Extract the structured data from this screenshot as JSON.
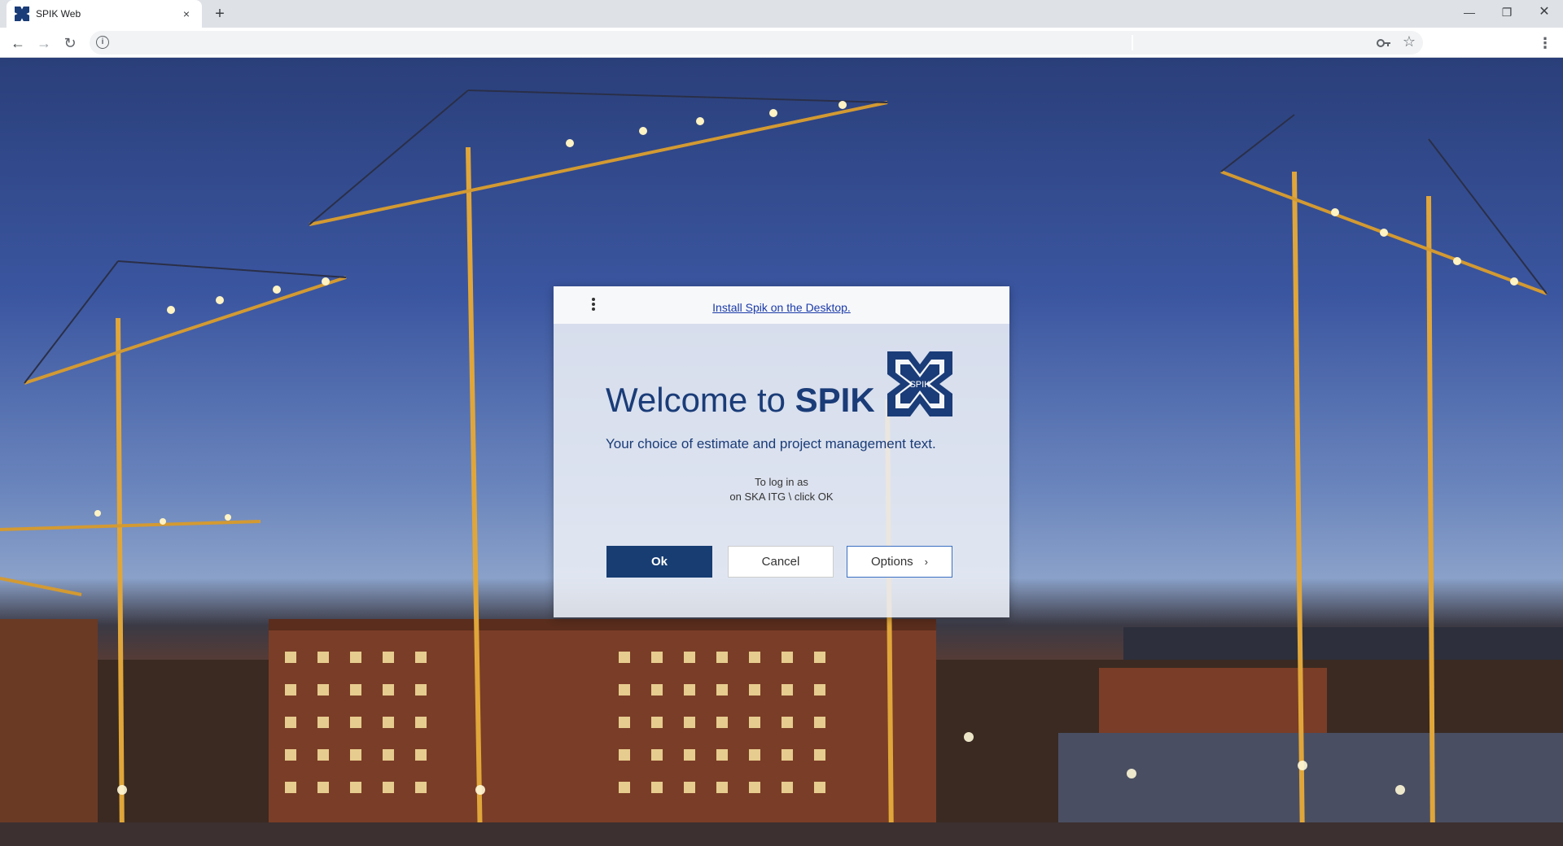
{
  "browser": {
    "tab_title": "SPIK Web",
    "tab_close": "×",
    "new_tab": "+",
    "window": {
      "minimize": "—",
      "maximize": "❐",
      "close": "✕"
    },
    "nav": {
      "back": "←",
      "forward": "→",
      "reload": "↻"
    },
    "omnibox_info": "i",
    "star": "☆",
    "menu": "⋮"
  },
  "dialog": {
    "install_link": "Install Spik on the Desktop.",
    "welcome_prefix": "Welcome to ",
    "welcome_brand": "SPIK",
    "logo_text": "SPIK",
    "tagline": "Your choice of estimate and project management text.",
    "login_line1": "To log in as",
    "login_line2": "on SKA ITG \\ click OK",
    "buttons": {
      "ok": "Ok",
      "cancel": "Cancel",
      "options": "Options",
      "options_chevron": "›"
    }
  },
  "colors": {
    "brand_blue": "#173d73",
    "text_blue": "#1a3c78",
    "link_blue": "#1a3aa8"
  },
  "icons": [
    "spik-logo-icon",
    "close-icon",
    "plus-icon",
    "back-arrow-icon",
    "forward-arrow-icon",
    "reload-icon",
    "info-icon",
    "key-icon",
    "star-icon",
    "kebab-menu-icon",
    "chevron-right-icon"
  ]
}
